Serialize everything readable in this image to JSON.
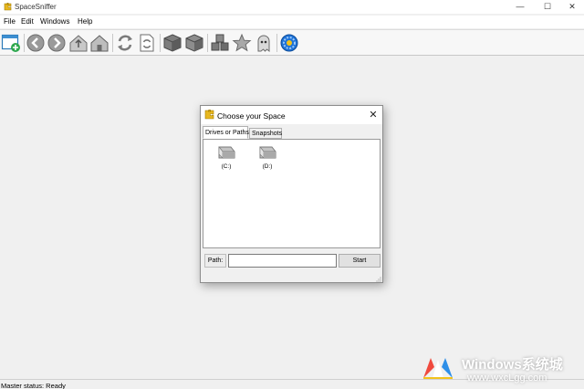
{
  "app": {
    "title": "SpaceSniffer",
    "icon": "puzzle-piece-icon"
  },
  "window_controls": {
    "minimize": "—",
    "maximize": "☐",
    "close": "✕"
  },
  "menu": {
    "items": [
      "File",
      "Edit",
      "Windows",
      "Help"
    ]
  },
  "toolbar": {
    "buttons": [
      "new-window-icon",
      "back-icon",
      "forward-icon",
      "parent-folder-icon",
      "home-icon",
      "refresh-icon",
      "refresh-document-icon",
      "box-icon",
      "box-open-icon",
      "boxes-icon",
      "star-icon",
      "ghost-icon",
      "gear-icon"
    ]
  },
  "dialog": {
    "title": "Choose your Space",
    "close": "✕",
    "tabs": [
      "Drives or Paths",
      "Snapshots"
    ],
    "active_tab": "Drives or Paths",
    "drives": [
      {
        "label": "(C:)"
      },
      {
        "label": "(D:)"
      }
    ],
    "path_label": "Path:",
    "path_value": "",
    "start_label": "Start"
  },
  "status": {
    "text": "Master status: Ready"
  },
  "watermark": {
    "title": "Windows系统城",
    "url": "www.wxcLgg.com"
  },
  "colors": {
    "background": "#f0f0f0",
    "toolbar_background": "#f7f7f7",
    "panel_background": "#ffffff",
    "gear_blue": "#1e73d8",
    "icon_gold": "#e8b820"
  }
}
